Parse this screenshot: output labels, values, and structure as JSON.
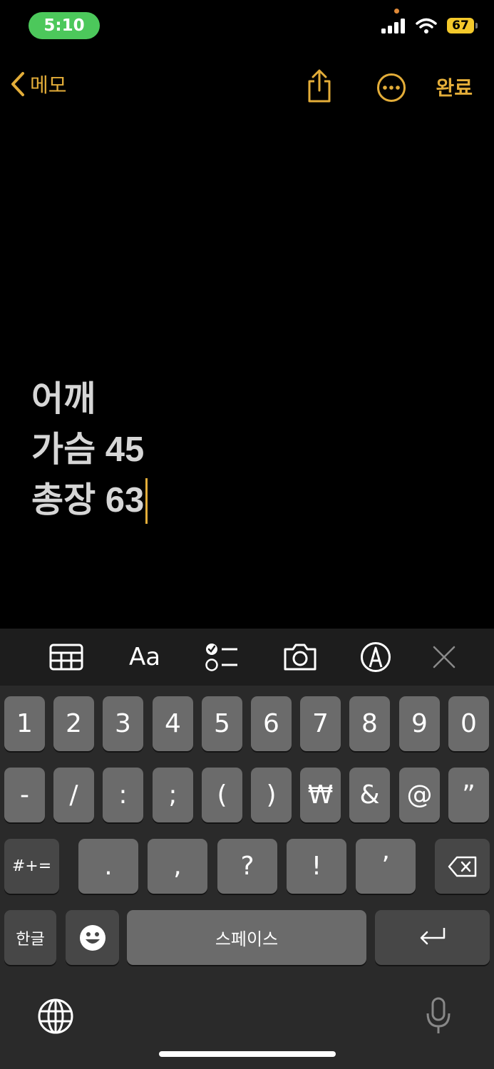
{
  "status": {
    "time": "5:10",
    "battery": "67"
  },
  "nav": {
    "back_label": "메모",
    "done_label": "완료"
  },
  "note": {
    "lines": [
      "어깨",
      "가슴 45",
      "총장 63"
    ]
  },
  "toolbar": {
    "icons": [
      "table-icon",
      "format-text-icon",
      "checklist-icon",
      "camera-icon",
      "markup-icon",
      "close-icon"
    ],
    "format_label": "Aa"
  },
  "keyboard": {
    "row1": [
      "1",
      "2",
      "3",
      "4",
      "5",
      "6",
      "7",
      "8",
      "9",
      "0"
    ],
    "row2": [
      "-",
      "/",
      ":",
      ";",
      "(",
      ")",
      "₩",
      "&",
      "@",
      "”"
    ],
    "row3_left": "#+=",
    "row3": [
      ".",
      ",",
      "?",
      "!",
      "’"
    ],
    "lang_key": "한글",
    "space_label": "스페이스"
  },
  "colors": {
    "accent": "#e3ad39",
    "time_pill": "#4cc85b",
    "battery": "#f4c92b"
  }
}
